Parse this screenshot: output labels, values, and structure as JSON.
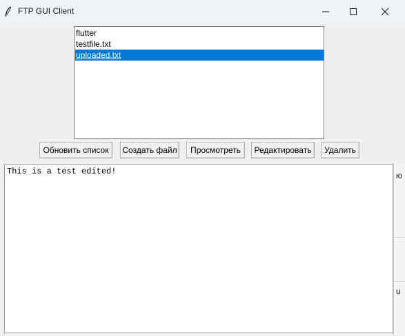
{
  "window": {
    "title": "FTP GUI Client",
    "icon": "feather-icon",
    "controls": [
      "minimize-icon",
      "maximize-icon",
      "close-icon"
    ]
  },
  "file_list": {
    "items": [
      "flutter",
      "testfile.txt",
      "uploaded.txt"
    ],
    "selected_index": 2
  },
  "toolbar": {
    "refresh_label": "Обновить список",
    "create_label": "Создать файл",
    "view_label": "Просмотреть",
    "edit_label": "Редактировать",
    "delete_label": "Удалить"
  },
  "editor": {
    "content": "This is a test edited!"
  },
  "background": {
    "fragment_1": "ю",
    "fragment_2": "u"
  },
  "colors": {
    "selection": "#0078d7",
    "titlebar": "#eef3f8",
    "window_bg": "#f0f0f0"
  }
}
